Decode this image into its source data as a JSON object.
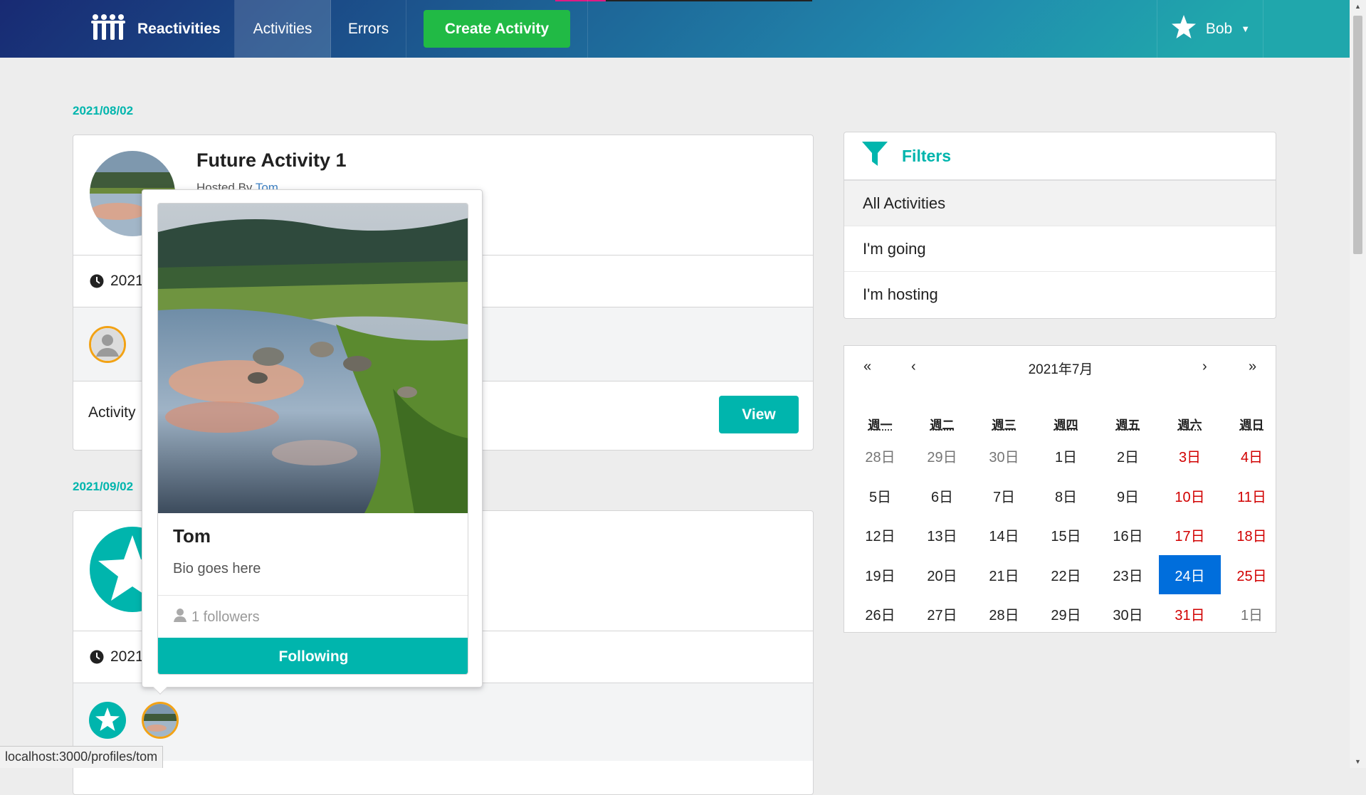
{
  "nav": {
    "brand": "Reactivities",
    "activities": "Activities",
    "errors": "Errors",
    "create": "Create Activity",
    "user": "Bob"
  },
  "groups": [
    {
      "date": "2021/08/02",
      "activity": {
        "title": "Future Activity 1",
        "hosted_prefix": "Hosted By ",
        "host": "Tom",
        "time_partial": "2021",
        "description_partial": "Activity",
        "view": "View"
      }
    },
    {
      "date": "2021/09/02",
      "activity": {
        "time_partial": "2021"
      }
    }
  ],
  "popup": {
    "name": "Tom",
    "bio": "Bio goes here",
    "followers": "1 followers",
    "button": "Following"
  },
  "filters": {
    "header": "Filters",
    "items": [
      "All Activities",
      "I'm going",
      "I'm hosting"
    ]
  },
  "calendar": {
    "title": "2021年7月",
    "prev2": "«",
    "prev": "‹",
    "next": "›",
    "next2": "»",
    "weekdays": [
      "週一",
      "週二",
      "週三",
      "週四",
      "週五",
      "週六",
      "週日"
    ],
    "weeks": [
      [
        "28日",
        "29日",
        "30日",
        "1日",
        "2日",
        "3日",
        "4日"
      ],
      [
        "5日",
        "6日",
        "7日",
        "8日",
        "9日",
        "10日",
        "11日"
      ],
      [
        "12日",
        "13日",
        "14日",
        "15日",
        "16日",
        "17日",
        "18日"
      ],
      [
        "19日",
        "20日",
        "21日",
        "22日",
        "23日",
        "24日",
        "25日"
      ],
      [
        "26日",
        "27日",
        "28日",
        "29日",
        "30日",
        "31日",
        "1日"
      ]
    ],
    "selected": "24日"
  },
  "status_url": "localhost:3000/profiles/tom",
  "colors": {
    "teal": "#00b5ad",
    "green": "#21ba45",
    "weekend": "#d10000",
    "selected": "#006edc"
  }
}
